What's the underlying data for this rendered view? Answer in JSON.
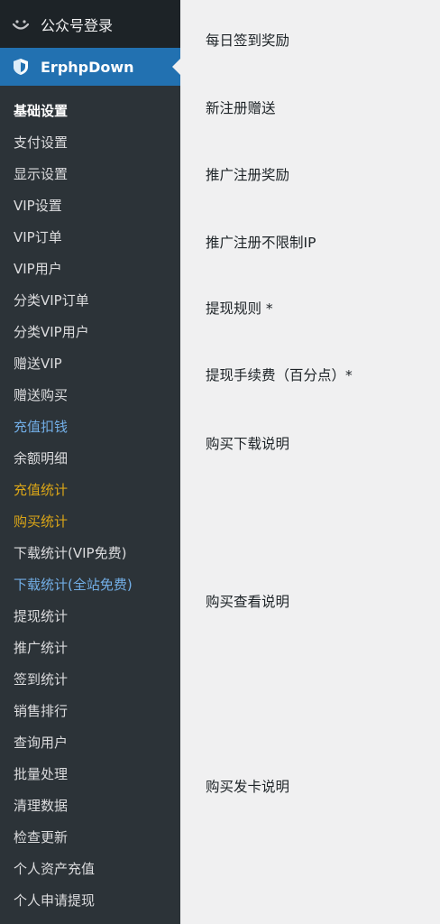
{
  "sidebar": {
    "top_item": {
      "label": "公众号登录",
      "icon": "smiley-icon"
    },
    "active_item": {
      "label": "ErphpDown",
      "icon": "shield-icon"
    },
    "colors": {
      "background": "#2c3338",
      "active": "#2271b1",
      "blue": "#72aee6",
      "orange": "#dba617"
    },
    "submenu": [
      {
        "label": "基础设置",
        "style": "current"
      },
      {
        "label": "支付设置",
        "style": "normal"
      },
      {
        "label": "显示设置",
        "style": "normal"
      },
      {
        "label": "VIP设置",
        "style": "normal"
      },
      {
        "label": "VIP订单",
        "style": "normal"
      },
      {
        "label": "VIP用户",
        "style": "normal"
      },
      {
        "label": "分类VIP订单",
        "style": "normal"
      },
      {
        "label": "分类VIP用户",
        "style": "normal"
      },
      {
        "label": "赠送VIP",
        "style": "normal"
      },
      {
        "label": "赠送购买",
        "style": "normal"
      },
      {
        "label": "充值扣钱",
        "style": "blue"
      },
      {
        "label": "余额明细",
        "style": "normal"
      },
      {
        "label": "充值统计",
        "style": "orange"
      },
      {
        "label": "购买统计",
        "style": "orange"
      },
      {
        "label": "下载统计(VIP免费)",
        "style": "normal"
      },
      {
        "label": "下载统计(全站免费)",
        "style": "blue"
      },
      {
        "label": "提现统计",
        "style": "normal"
      },
      {
        "label": "推广统计",
        "style": "normal"
      },
      {
        "label": "签到统计",
        "style": "normal"
      },
      {
        "label": "销售排行",
        "style": "normal"
      },
      {
        "label": "查询用户",
        "style": "normal"
      },
      {
        "label": "批量处理",
        "style": "normal"
      },
      {
        "label": "清理数据",
        "style": "normal"
      },
      {
        "label": "检查更新",
        "style": "normal"
      },
      {
        "label": "个人资产充值",
        "style": "normal"
      },
      {
        "label": "个人申请提现",
        "style": "normal"
      }
    ]
  },
  "main": {
    "fields": [
      {
        "label": "每日签到奖励"
      },
      {
        "label": "新注册赠送"
      },
      {
        "label": "推广注册奖励"
      },
      {
        "label": "推广注册不限制IP"
      },
      {
        "label": "提现规则 *"
      },
      {
        "label": "提现手续费（百分点）*"
      },
      {
        "label": "购买下载说明"
      },
      {
        "label": "购买查看说明"
      },
      {
        "label": "购买发卡说明"
      }
    ]
  }
}
